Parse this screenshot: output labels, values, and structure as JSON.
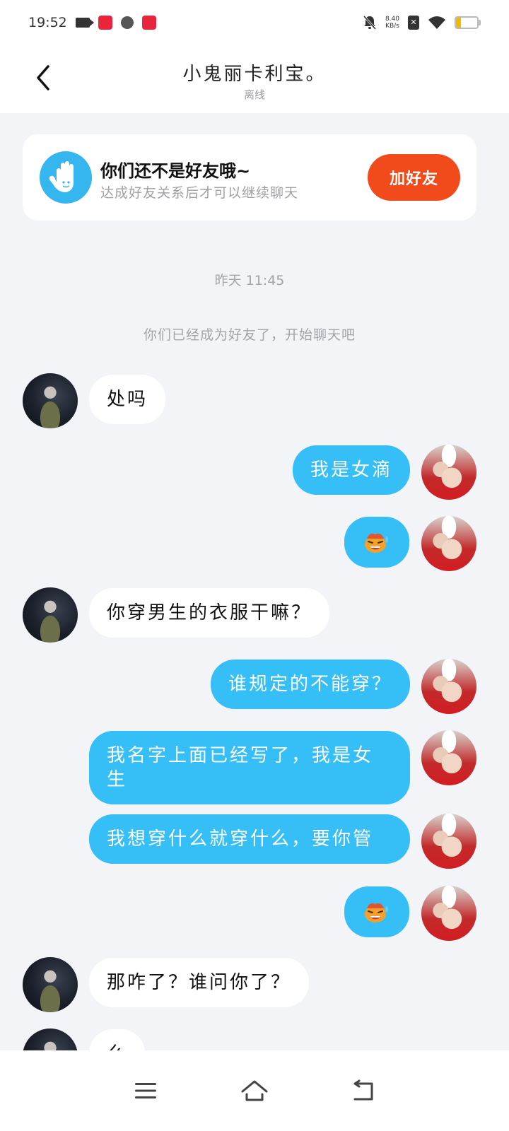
{
  "status_bar": {
    "time": "19:52",
    "network_speed_value": "8.40",
    "network_speed_unit": "KB/s",
    "battery_level": "22",
    "battery_percent": 22
  },
  "header": {
    "title": "小鬼丽卡利宝。",
    "status": "离线"
  },
  "friend_card": {
    "title": "你们还不是好友哦~",
    "subtitle": "达成好友关系后才可以继续聊天",
    "button_label": "加好友"
  },
  "chat": {
    "timestamp": "昨天 11:45",
    "system_note": "你们已经成为好友了，开始聊天吧",
    "messages": [
      {
        "from": "other",
        "text": "处吗"
      },
      {
        "from": "me",
        "text": "我是女滴"
      },
      {
        "from": "me",
        "emoji": "sweating-emoji"
      },
      {
        "from": "other",
        "text": "你穿男生的衣服干嘛？"
      },
      {
        "from": "me",
        "text": "谁规定的不能穿？"
      },
      {
        "from": "me",
        "text": "我名字上面已经写了，我是女生"
      },
      {
        "from": "me",
        "text": "我想穿什么就穿什么，要你管"
      },
      {
        "from": "me",
        "emoji": "sweating-emoji"
      },
      {
        "from": "other",
        "text": "那咋了？谁问你了？"
      },
      {
        "from": "other",
        "text": "么"
      }
    ]
  },
  "colors": {
    "accent": "#35bff6",
    "add_button": "#f14b1b",
    "background": "#f3f4f8"
  },
  "nav": {
    "icons": [
      "menu-icon",
      "home-icon",
      "back-icon"
    ]
  }
}
